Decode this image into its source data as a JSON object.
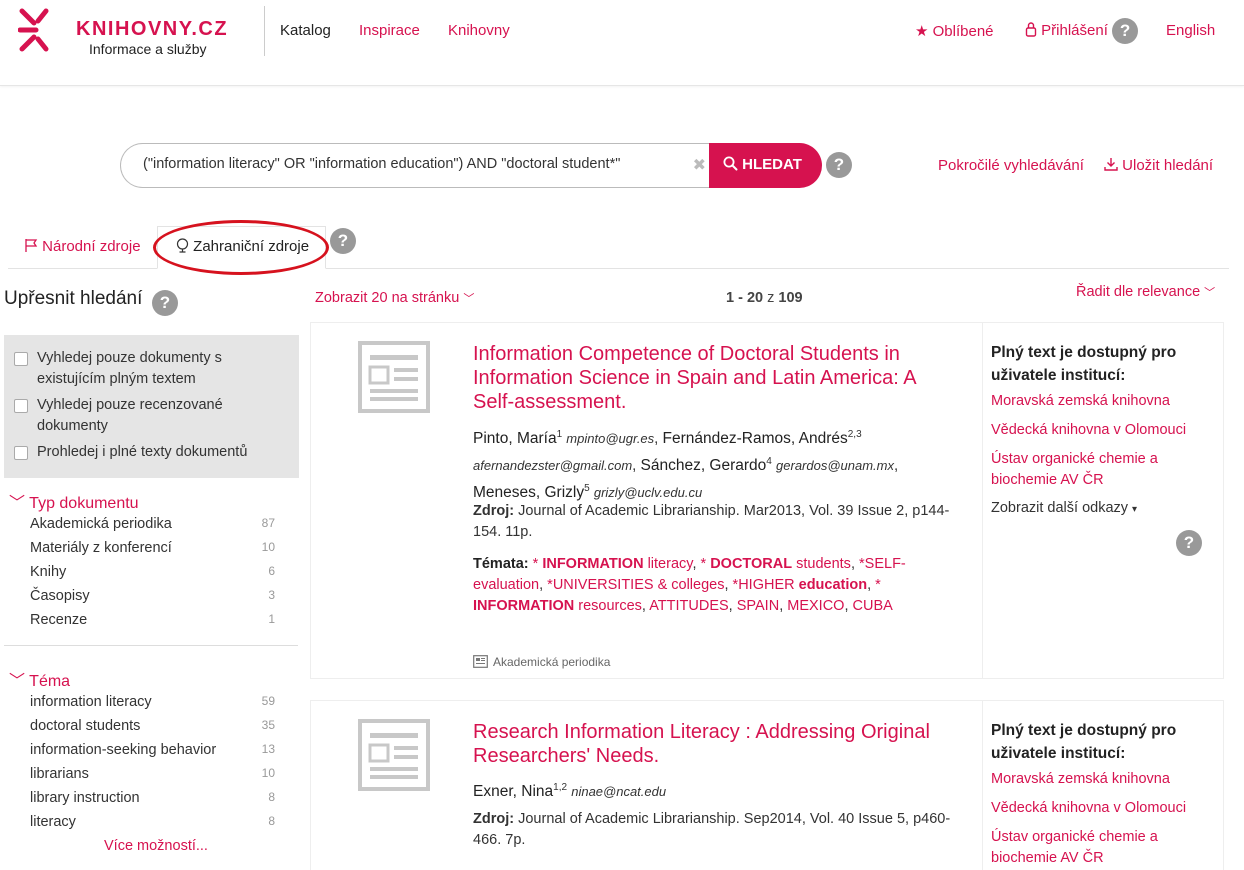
{
  "header": {
    "logo_text": "KNIHOVNY.CZ",
    "logo_sub": "Informace a služby",
    "nav": [
      "Katalog",
      "Inspirace",
      "Knihovny"
    ],
    "favorites": "Oblíbené",
    "login": "Přihlášení",
    "language": "English"
  },
  "search": {
    "query": "(\"information literacy\" OR \"information education\") AND \"doctoral student*\"",
    "button": "HLEDAT",
    "advanced": "Pokročilé vyhledávání",
    "save": "Uložit hledání"
  },
  "tabs": {
    "national": "Národní zdroje",
    "foreign": "Zahraniční zdroje"
  },
  "sidebar": {
    "title": "Upřesnit hledání",
    "filters": [
      "Vyhledej pouze dokumenty s existujícím plným textem",
      "Vyhledej pouze recenzované dokumenty",
      "Prohledej i plné texty dokumentů"
    ],
    "doc_type_head": "Typ dokumentu",
    "doc_types": [
      {
        "label": "Akademická periodika",
        "count": "87"
      },
      {
        "label": "Materiály z konferencí",
        "count": "10"
      },
      {
        "label": "Knihy",
        "count": "6"
      },
      {
        "label": "Časopisy",
        "count": "3"
      },
      {
        "label": "Recenze",
        "count": "1"
      }
    ],
    "topic_head": "Téma",
    "topics": [
      {
        "label": "information literacy",
        "count": "59"
      },
      {
        "label": "doctoral students",
        "count": "35"
      },
      {
        "label": "information-seeking behavior",
        "count": "13"
      },
      {
        "label": "librarians",
        "count": "10"
      },
      {
        "label": "library instruction",
        "count": "8"
      },
      {
        "label": "literacy",
        "count": "8"
      }
    ],
    "more": "Více možností..."
  },
  "results_bar": {
    "per_page": "Zobrazit 20 na stránku",
    "range": "1 - 20",
    "of": "z",
    "total": "109",
    "sort": "Řadit dle relevance"
  },
  "results": [
    {
      "title": "Information Competence of Doctoral Students in Information Science in Spain and Latin America: A Self-assessment.",
      "a1_name": "Pinto, María",
      "a1_sup": "1",
      "a1_email": "mpinto@ugr.es",
      "a2_name": "Fernández-Ramos, Andrés",
      "a2_sup": "2,3",
      "a2_email": "afernandezster@gmail.com",
      "a3_name": "Sánchez, Gerardo",
      "a3_sup": "4",
      "a3_email": "gerardos@unam.mx",
      "a4_name": "Meneses, Grizly",
      "a4_sup": "5",
      "a4_email": "grizly@uclv.edu.cu",
      "source_label": "Zdroj:",
      "source": "Journal of Academic Librarianship. Mar2013, Vol. 39 Issue 2, p144-154. 11p.",
      "topics_label": "Témata:",
      "topics": [
        {
          "pre": "*",
          "bold": "INFORMATION",
          "rest": " literacy"
        },
        {
          "pre": "*",
          "bold": "DOCTORAL",
          "rest": " students"
        },
        {
          "pre": "*",
          "bold": "",
          "rest": "SELF-evaluation"
        },
        {
          "pre": "*",
          "bold": "",
          "rest": "UNIVERSITIES & colleges"
        },
        {
          "pre": "*",
          "bold": "",
          "rest": "HIGHER "
        },
        {
          "pre": "*",
          "bold": "INFORMATION",
          "rest": " resources"
        },
        {
          "pre": "",
          "bold": "",
          "rest": "ATTITUDES"
        },
        {
          "pre": "",
          "bold": "",
          "rest": "SPAIN"
        },
        {
          "pre": "",
          "bold": "",
          "rest": "MEXICO"
        },
        {
          "pre": "",
          "bold": "",
          "rest": "CUBA"
        }
      ],
      "topic_higher_bold": "education",
      "doc_type": "Akademická periodika",
      "fulltext_title": "Plný text je dostupný pro uživatele institucí:",
      "fulltext_links": [
        "Moravská zemská knihovna",
        "Vědecká knihovna v Olomouci",
        "Ústav organické chemie a biochemie AV ČR"
      ],
      "more_links": "Zobrazit další odkazy"
    },
    {
      "title": "Research Information Literacy : Addressing Original Researchers' Needs.",
      "a1_name": "Exner, Nina",
      "a1_sup": "1,2",
      "a1_email": "ninae@ncat.edu",
      "source_label": "Zdroj:",
      "source": "Journal of Academic Librarianship. Sep2014, Vol. 40 Issue 5, p460-466. 7p.",
      "fulltext_title": "Plný text je dostupný pro uživatele institucí:",
      "fulltext_links": [
        "Moravská zemská knihovna",
        "Vědecká knihovna v Olomouci",
        "Ústav organické chemie a biochemie AV ČR"
      ]
    }
  ]
}
